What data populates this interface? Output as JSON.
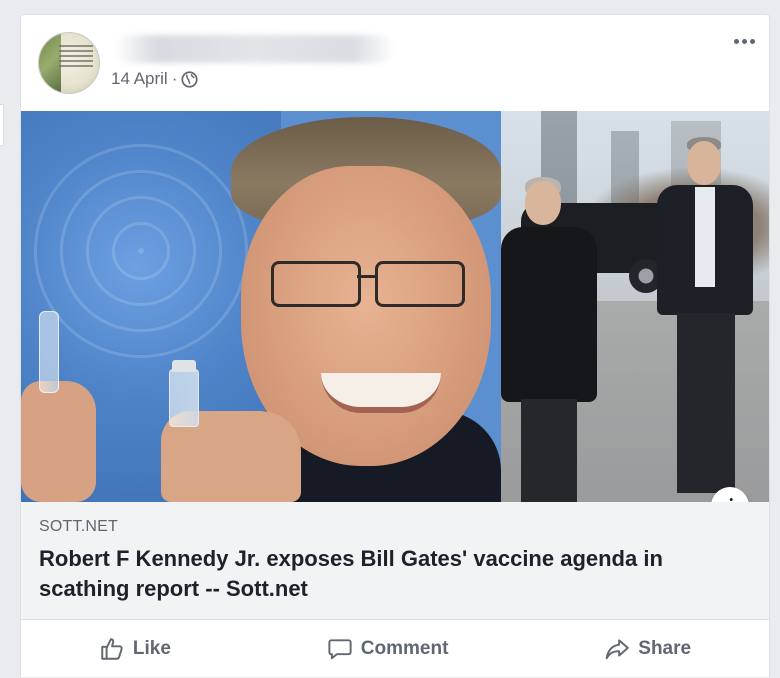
{
  "post": {
    "timestamp": "14 April",
    "separator": "·",
    "privacy_icon": "globe-icon",
    "more_icon": "more-horizontal-icon",
    "author_name_blurred": true
  },
  "link": {
    "domain": "SOTT.NET",
    "headline": "Robert F Kennedy Jr. exposes Bill Gates' vaccine agenda in scathing report -- Sott.net",
    "info_icon_label": "i"
  },
  "actions": {
    "like_label": "Like",
    "comment_label": "Comment",
    "share_label": "Share"
  },
  "colors": {
    "page_background": "#e9ebee",
    "card_background": "#ffffff",
    "preview_background": "#f2f3f5",
    "secondary_text": "#606770",
    "headline_text": "#1d2129"
  }
}
